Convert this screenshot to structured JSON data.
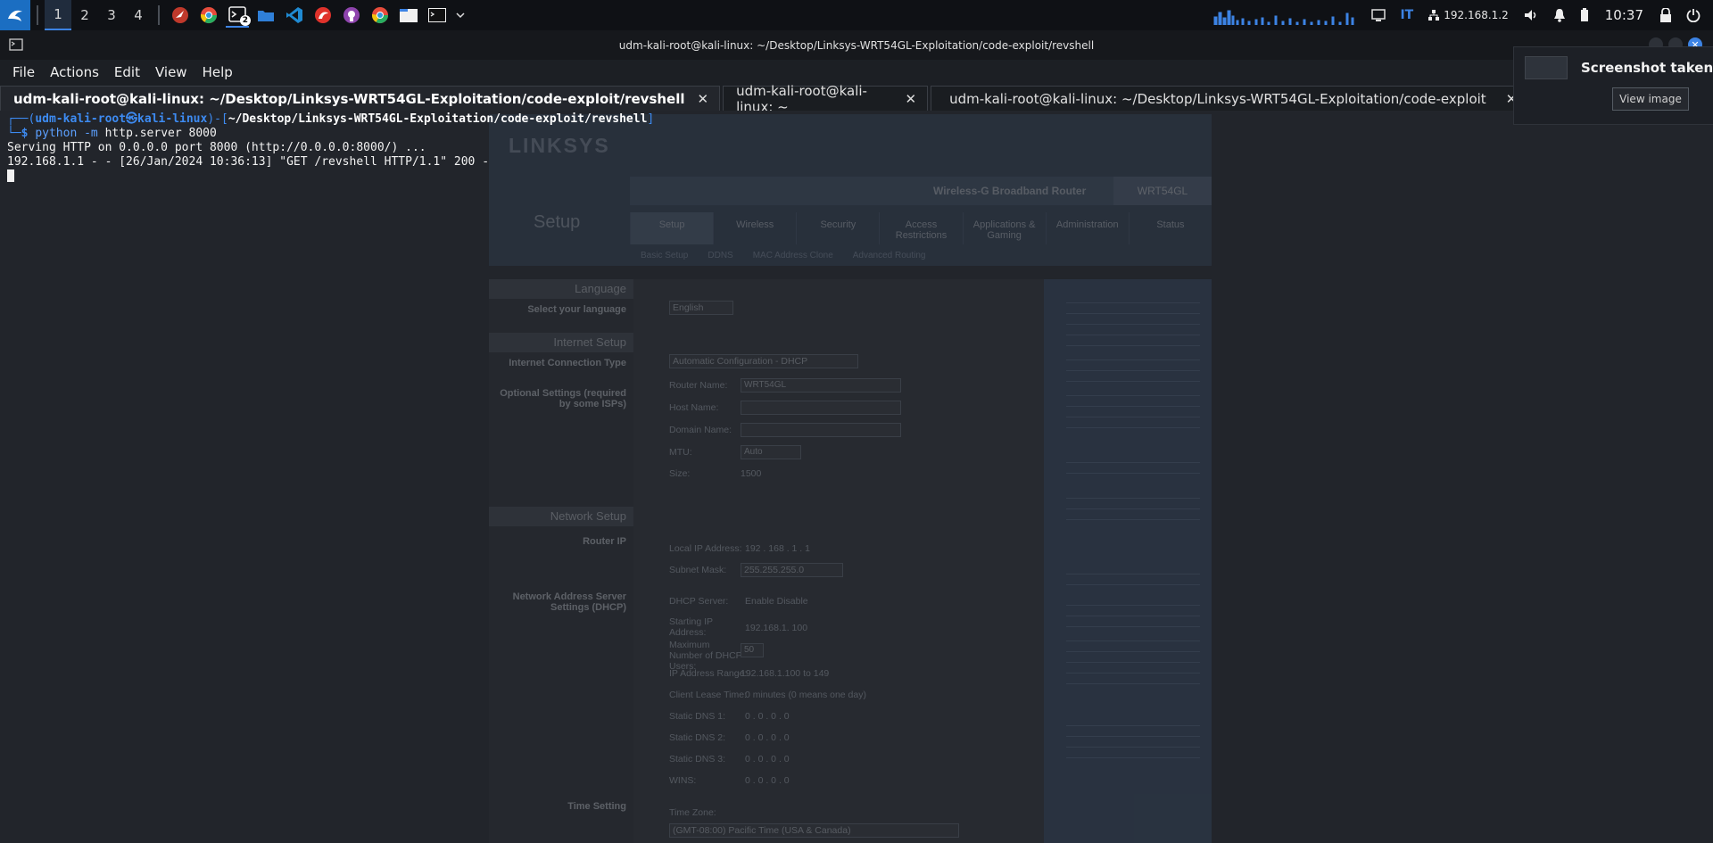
{
  "taskbar": {
    "workspaces": [
      "1",
      "2",
      "3",
      "4"
    ],
    "active_workspace": "1",
    "apps": [
      {
        "icon": "kali-dragon-icon"
      },
      {
        "icon": "chrome-icon"
      },
      {
        "icon": "terminal-icon",
        "badge": "2"
      },
      {
        "icon": "folder-icon"
      },
      {
        "icon": "vscode-icon"
      },
      {
        "icon": "kali-tool-icon"
      },
      {
        "icon": "github-icon"
      },
      {
        "icon": "chrome-icon"
      },
      {
        "icon": "file-manager-icon"
      },
      {
        "icon": "terminal-icon"
      }
    ],
    "keyboard_layout": "IT",
    "ip_address": "192.168.1.2",
    "clock": "10:37"
  },
  "window": {
    "title": "udm-kali-root@kali-linux: ~/Desktop/Linksys-WRT54GL-Exploitation/code-exploit/revshell",
    "menu": [
      "File",
      "Actions",
      "Edit",
      "View",
      "Help"
    ],
    "tabs": [
      {
        "label": "udm-kali-root@kali-linux: ~/Desktop/Linksys-WRT54GL-Exploitation/code-exploit/revshell",
        "active": true
      },
      {
        "label": "udm-kali-root@kali-linux: ~",
        "active": false
      },
      {
        "label": "udm-kali-root@kali-linux: ~/Desktop/Linksys-WRT54GL-Exploitation/code-exploit",
        "active": false
      }
    ],
    "close_glyph": "✕"
  },
  "terminal": {
    "prompt_prefix": "┌──(",
    "prompt_user": "udm-kali-root㉿kali-linux",
    "prompt_mid": ")-[",
    "prompt_path": "~/Desktop/Linksys-WRT54GL-Exploitation/code-exploit/revshell",
    "prompt_end": "]",
    "prompt_line2_prefix": "└─",
    "prompt_dollar": "$ ",
    "command_name": "python",
    "command_flag": " -m",
    "command_args": " http.server 8000",
    "output": [
      "Serving HTTP on 0.0.0.0 port 8000 (http://0.0.0.0:8000/) ...",
      "192.168.1.1 - - [26/Jan/2024 10:36:13] \"GET /revshell HTTP/1.1\" 200 -"
    ]
  },
  "background_page": {
    "logo": "LINKSYS",
    "product_name": "Wireless-G Broadband Router",
    "model": "WRT54GL",
    "section_title": "Setup",
    "tabs": [
      "Setup",
      "Wireless",
      "Security",
      "Access Restrictions",
      "Applications & Gaming",
      "Administration",
      "Status"
    ],
    "subtabs": [
      "Basic Setup",
      "DDNS",
      "MAC Address Clone",
      "Advanced Routing"
    ],
    "sections": {
      "language": "Language",
      "internet_setup": "Internet Setup",
      "network_setup": "Network Setup"
    },
    "labels": {
      "select_language": "Select your language",
      "connection_type": "Internet Connection Type",
      "optional_settings": "Optional Settings (required by some ISPs)",
      "router_ip": "Router IP",
      "dhcp_settings": "Network Address Server Settings (DHCP)",
      "time_setting": "Time Setting"
    },
    "language_value": "English",
    "connection_type_value": "Automatic Configuration - DHCP",
    "fields": [
      {
        "label": "Router Name:",
        "value": "WRT54GL"
      },
      {
        "label": "Host Name:",
        "value": ""
      },
      {
        "label": "Domain Name:",
        "value": ""
      },
      {
        "label": "MTU:",
        "value": "Auto"
      },
      {
        "label": "Size:",
        "value": "1500"
      }
    ],
    "lan": [
      {
        "label": "Local IP Address:",
        "value": "192 . 168 . 1 . 1"
      },
      {
        "label": "Subnet Mask:",
        "value": "255.255.255.0"
      },
      {
        "label": "DHCP Server:",
        "value": "Enable   Disable"
      },
      {
        "label": "Starting IP Address:",
        "value": "192.168.1. 100"
      },
      {
        "label": "Maximum Number of DHCP Users:",
        "value": "50"
      },
      {
        "label": "IP Address Range:",
        "value": "192.168.1.100 to 149"
      },
      {
        "label": "Client Lease Time:",
        "value": "0   minutes (0 means one day)"
      },
      {
        "label": "Static DNS 1:",
        "value": "0 . 0 . 0 . 0"
      },
      {
        "label": "Static DNS 2:",
        "value": "0 . 0 . 0 . 0"
      },
      {
        "label": "Static DNS 3:",
        "value": "0 . 0 . 0 . 0"
      },
      {
        "label": "WINS:",
        "value": "0 . 0 . 0 . 0"
      }
    ],
    "time_zone_label": "Time Zone:",
    "time_zone_value": "(GMT-08:00) Pacific Time (USA & Canada)"
  },
  "notification": {
    "title": "Screenshot taken",
    "button": "View image"
  },
  "colors": {
    "accent": "#3c83e4",
    "prompt": "#3d8bf2",
    "terminal_bg": "#22252b"
  }
}
